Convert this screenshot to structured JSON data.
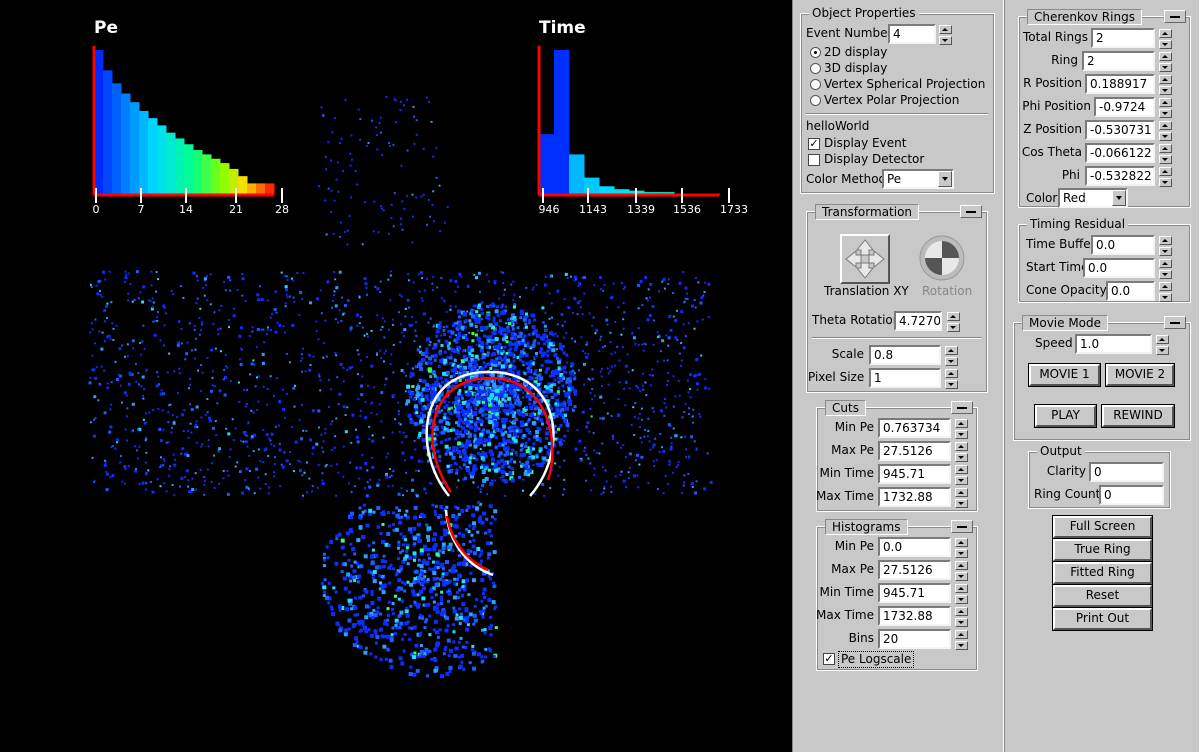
{
  "viewer": {
    "pe_title": "Pe",
    "time_title": "Time",
    "pe_ticks": [
      "0",
      "7",
      "14",
      "21",
      "28"
    ],
    "time_ticks": [
      "946",
      "1143",
      "1339",
      "1536",
      "1733"
    ],
    "colors": {
      "axis": "#ff0000",
      "ring_true": "#ffffff",
      "ring_fit": "#ff0000"
    }
  },
  "chart_data": [
    {
      "type": "bar",
      "title": "Pe",
      "x_ticks": [
        0,
        7,
        14,
        21,
        28
      ],
      "xlim": [
        0,
        28
      ],
      "values": [
        1.0,
        0.86,
        0.77,
        0.7,
        0.64,
        0.58,
        0.53,
        0.48,
        0.43,
        0.39,
        0.35,
        0.31,
        0.28,
        0.25,
        0.22,
        0.18,
        0.13,
        0.08,
        0.08,
        0.08
      ]
    },
    {
      "type": "bar",
      "title": "Time",
      "x_ticks": [
        946,
        1143,
        1339,
        1536,
        1733
      ],
      "xlim": [
        946,
        1733
      ],
      "values": [
        0.42,
        1.0,
        0.28,
        0.12,
        0.06,
        0.04,
        0.03,
        0.02,
        0.02,
        0.01,
        0.01,
        0.01
      ]
    }
  ],
  "object_properties": {
    "title": "Object Properties",
    "event_number_label": "Event Number",
    "event_number": "4",
    "display_options": [
      "2D display",
      "3D display",
      "Vertex Spherical Projection",
      "Vertex Polar Projection"
    ],
    "selected_display": "2D display",
    "hello_world": "helloWorld",
    "display_event_label": "Display Event",
    "display_event_checked": true,
    "display_detector_label": "Display Detector",
    "display_detector_checked": false,
    "color_method_label": "Color Method",
    "color_method": "Pe"
  },
  "transformation": {
    "title": "Transformation",
    "translation_label": "Translation XY",
    "rotation_label": "Rotation",
    "theta_label": "Theta Rotation",
    "theta": "4.7270",
    "scale_label": "Scale",
    "scale": "0.8",
    "pixel_size_label": "Pixel Size",
    "pixel_size": "1"
  },
  "cuts": {
    "title": "Cuts",
    "min_pe_label": "Min Pe",
    "min_pe": "0.763734",
    "max_pe_label": "Max Pe",
    "max_pe": "27.5126",
    "min_time_label": "Min Time",
    "min_time": "945.71",
    "max_time_label": "Max Time",
    "max_time": "1732.88"
  },
  "histograms": {
    "title": "Histograms",
    "min_pe_label": "Min Pe",
    "min_pe": "0.0",
    "max_pe_label": "Max Pe",
    "max_pe": "27.5126",
    "min_time_label": "Min Time",
    "min_time": "945.71",
    "max_time_label": "Max Time",
    "max_time": "1732.88",
    "bins_label": "Bins",
    "bins": "20",
    "pe_logscale_label": "Pe Logscale",
    "pe_logscale_checked": true
  },
  "cherenkov": {
    "title": "Cherenkov Rings",
    "total_rings_label": "Total Rings",
    "total_rings": "2",
    "ring_label": "Ring",
    "ring": "2",
    "r_position_label": "R Position",
    "r_position": "0.188917",
    "phi_position_label": "Phi Position",
    "phi_position": "-0.9724",
    "z_position_label": "Z Position",
    "z_position": "-0.530731",
    "cos_theta_label": "Cos Theta",
    "cos_theta": "-0.066122",
    "phi_label": "Phi",
    "phi": "-0.532822",
    "color_label": "Color",
    "color": "Red"
  },
  "timing": {
    "title": "Timing Residual",
    "time_buffer_label": "Time Buffer",
    "time_buffer": "0.0",
    "start_time_label": "Start Time",
    "start_time": "0.0",
    "cone_opacity_label": "Cone Opacity",
    "cone_opacity": "0.0"
  },
  "movie": {
    "title": "Movie Mode",
    "speed_label": "Speed",
    "speed": "1.0",
    "movie1": "MOVIE 1",
    "movie2": "MOVIE 2",
    "play": "PLAY",
    "rewind": "REWIND"
  },
  "output": {
    "title": "Output",
    "clarity_label": "Clarity",
    "clarity": "0",
    "ring_count_label": "Ring Count",
    "ring_count": "0"
  },
  "actions": {
    "full_screen": "Full Screen",
    "true_ring": "True Ring",
    "fitted_ring": "Fitted Ring",
    "reset": "Reset",
    "print_out": "Print Out"
  }
}
